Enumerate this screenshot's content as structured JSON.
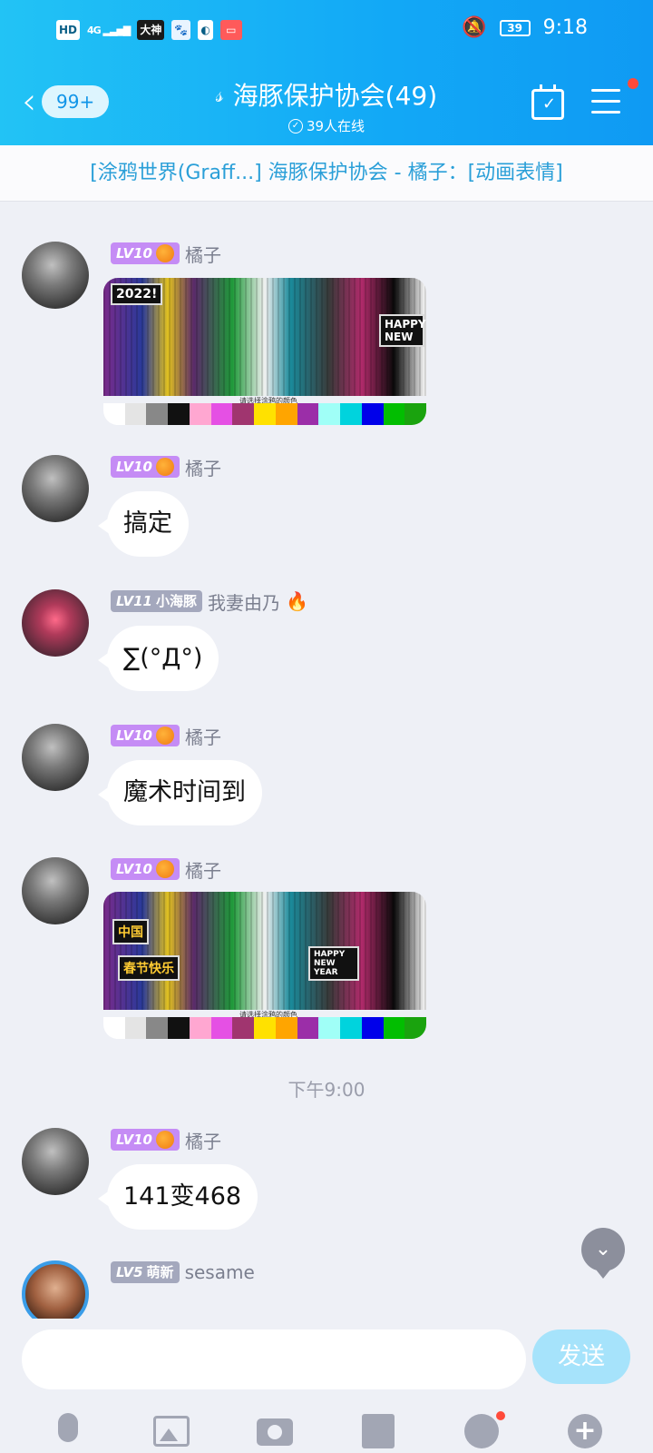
{
  "statusbar": {
    "left_chips": [
      "HD",
      "4G",
      "大神"
    ],
    "battery": "39",
    "time": "9:18"
  },
  "header": {
    "unread": "99+",
    "title": "海豚保护协会(49)",
    "online": "39人在线"
  },
  "notice": "[涂鸦世界(Graff...] 海豚保护协会 - 橘子：[动画表情]",
  "messages": [
    {
      "level": "LV10",
      "name": "橘子",
      "type": "image",
      "caption": "请选择涂鸦的颜色"
    },
    {
      "level": "LV10",
      "name": "橘子",
      "type": "text",
      "text": "搞定"
    },
    {
      "level": "LV11",
      "title": "小海豚",
      "name": "我妻由乃",
      "type": "text",
      "text": "∑(°Д°)"
    },
    {
      "level": "LV10",
      "name": "橘子",
      "type": "text",
      "text": "魔术时间到"
    },
    {
      "level": "LV10",
      "name": "橘子",
      "type": "image",
      "caption": "请选择涂鸦的颜色"
    },
    {
      "level": "LV10",
      "name": "橘子",
      "type": "text",
      "text": "141变468"
    },
    {
      "level": "LV5",
      "title": "萌新",
      "name": "sesame",
      "type": "text",
      "text": ""
    }
  ],
  "time_divider": "下午9:00",
  "pixel_labels": {
    "img1_a": "2022!",
    "img1_b": "HAPPY NEW",
    "img2_a": "中国",
    "img2_b": "春节快乐",
    "img2_c": "HAPPY NEW YEAR"
  },
  "composer": {
    "send_label": "发送",
    "input_value": ""
  },
  "palette": [
    "#ffffff",
    "#e4e4e4",
    "#888888",
    "#111111",
    "#ffa7d1",
    "#e550e4",
    "#a0356f",
    "#ffe100",
    "#ffa500",
    "#9b2ea8",
    "#a0fff7",
    "#00d3dd",
    "#0000ea",
    "#02be01",
    "#1aa30e"
  ],
  "colors": {
    "header_start": "#22c3f5",
    "header_end": "#0f9af3",
    "level_purple": "#c58cf5",
    "send_disabled": "#a6e3fb"
  }
}
